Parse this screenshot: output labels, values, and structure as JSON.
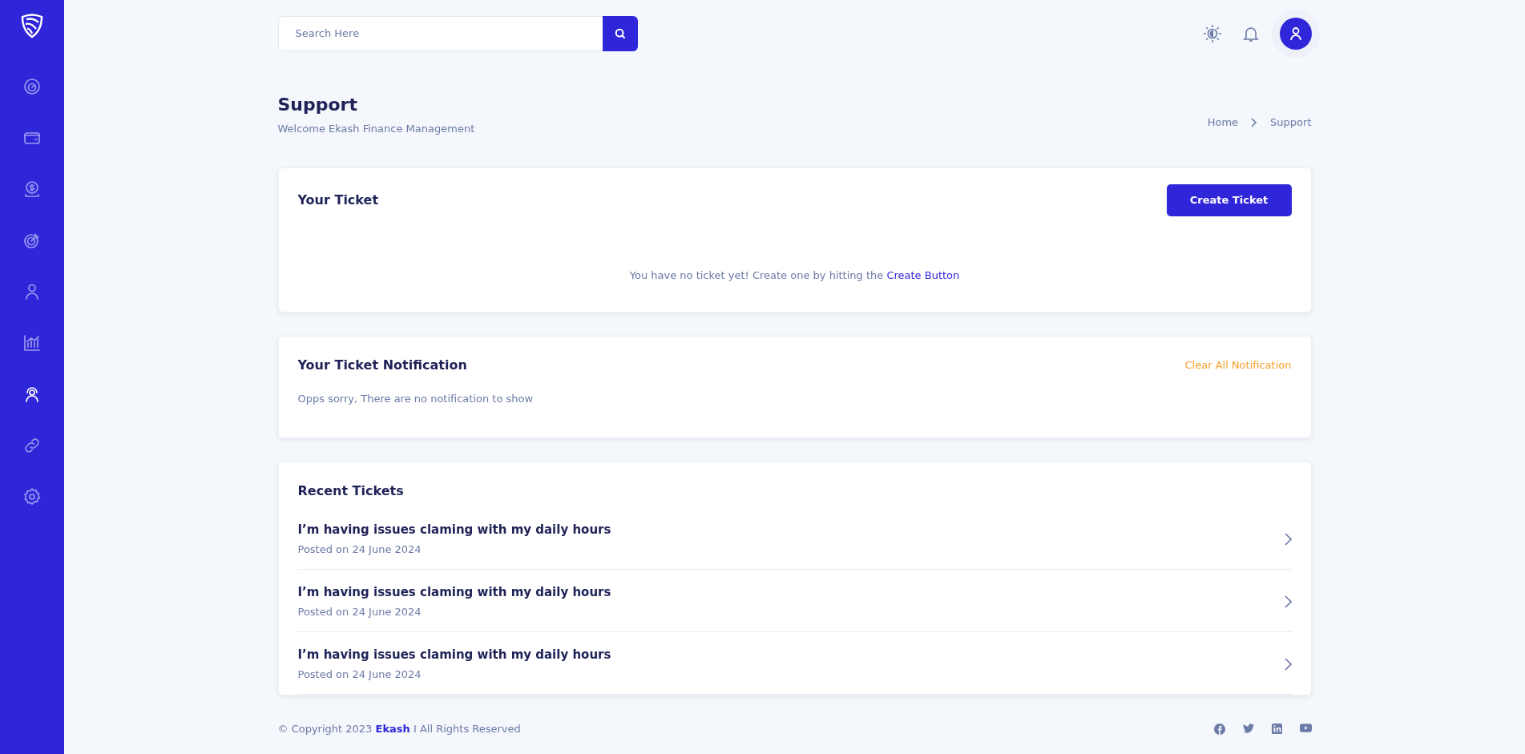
{
  "sidebar": {
    "items": [
      {
        "selected": false
      },
      {
        "selected": false
      },
      {
        "selected": false
      },
      {
        "selected": false
      },
      {
        "selected": false
      },
      {
        "selected": false
      },
      {
        "selected": true
      },
      {
        "selected": false
      },
      {
        "selected": false
      }
    ]
  },
  "search": {
    "placeholder": "Search Here"
  },
  "header": {
    "title": "Support",
    "subtitle": "Welcome Ekash Finance Management",
    "breadcrumb": [
      "Home",
      "Support"
    ]
  },
  "ticket_card": {
    "title": "Your Ticket",
    "button": "Create Ticket",
    "empty_text": "You have no ticket yet! Create one by hitting the ",
    "empty_link": "Create Button"
  },
  "notification_card": {
    "title": "Your Ticket Notification",
    "action": "Clear All Notification",
    "empty_text": "Opps sorry, There are no notification to show"
  },
  "recent_tickets": {
    "title": "Recent Tickets",
    "items": [
      {
        "title": "I’m having issues claming with my daily hours",
        "date": "Posted on 24 June 2024"
      },
      {
        "title": "I’m having issues claming with my daily hours",
        "date": "Posted on 24 June 2024"
      },
      {
        "title": "I’m having issues claming with my daily hours",
        "date": "Posted on 24 June 2024"
      }
    ]
  },
  "footer": {
    "prefix": "© Copyright 2023 ",
    "brand": "Ekash",
    "suffix": " I All Rights Reserved"
  }
}
